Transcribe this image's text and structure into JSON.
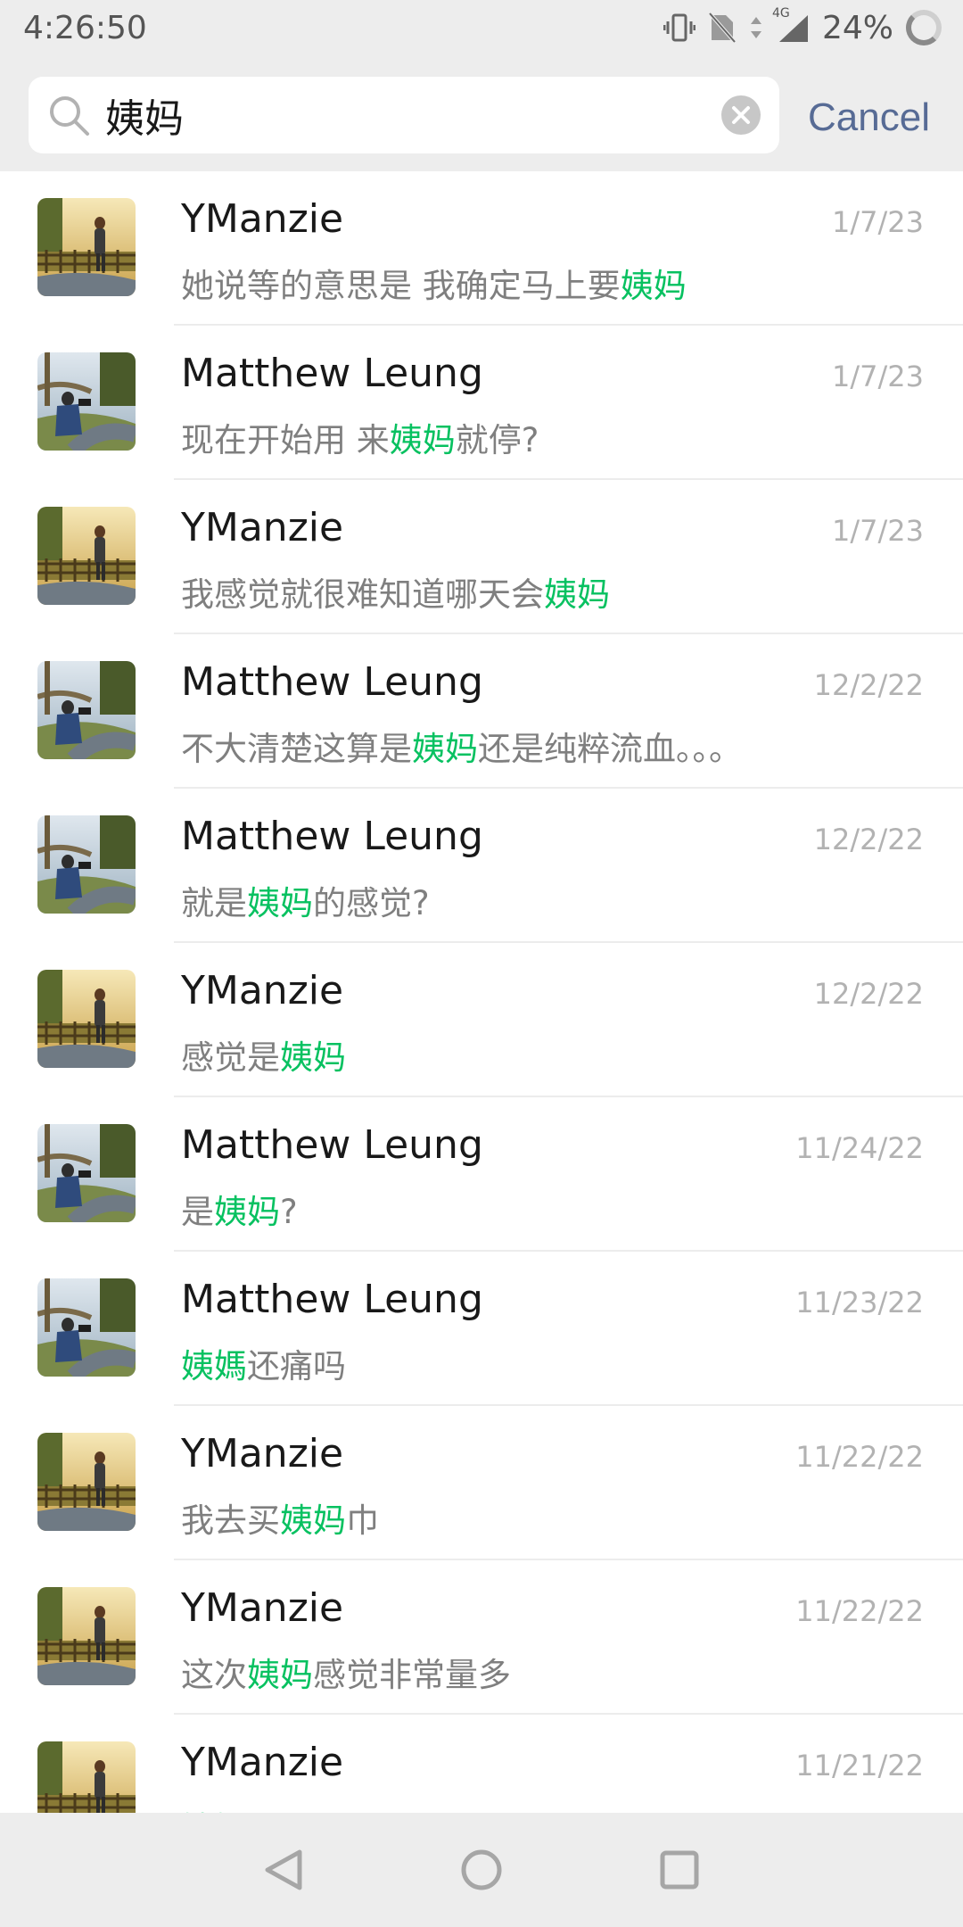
{
  "status_bar": {
    "time": "4:26:50",
    "network": "4G",
    "battery": "24%",
    "icons": [
      "vibrate-icon",
      "no-sim-icon",
      "data-arrows-icon",
      "signal-icon",
      "battery-ring-icon"
    ]
  },
  "search": {
    "query": "姨妈",
    "placeholder": "",
    "cancel_label": "Cancel"
  },
  "colors": {
    "highlight": "#07c160",
    "cancel": "#576b95",
    "name": "#191919",
    "message": "#7f7f7f",
    "date": "#b2b2b2",
    "header_bg": "#ededed"
  },
  "results": [
    {
      "name": "YManzie",
      "date": "1/7/23",
      "msg_before": "她说等的意思是 我确定马上要",
      "msg_highlight": "姨妈",
      "msg_after": "",
      "avatar": "ymanzie"
    },
    {
      "name": "Matthew Leung",
      "date": "1/7/23",
      "msg_before": "现在开始用 来",
      "msg_highlight": "姨妈",
      "msg_after": "就停?",
      "avatar": "matthew"
    },
    {
      "name": "YManzie",
      "date": "1/7/23",
      "msg_before": "我感觉就很难知道哪天会",
      "msg_highlight": "姨妈",
      "msg_after": "",
      "avatar": "ymanzie"
    },
    {
      "name": "Matthew Leung",
      "date": "12/2/22",
      "msg_before": "不大清楚这算是",
      "msg_highlight": "姨妈",
      "msg_after": "还是纯粹流血。。。",
      "avatar": "matthew"
    },
    {
      "name": "Matthew Leung",
      "date": "12/2/22",
      "msg_before": "就是",
      "msg_highlight": "姨妈",
      "msg_after": "的感觉?",
      "avatar": "matthew"
    },
    {
      "name": "YManzie",
      "date": "12/2/22",
      "msg_before": "感觉是",
      "msg_highlight": "姨妈",
      "msg_after": "",
      "avatar": "ymanzie"
    },
    {
      "name": "Matthew Leung",
      "date": "11/24/22",
      "msg_before": "是",
      "msg_highlight": "姨妈",
      "msg_after": "?",
      "avatar": "matthew"
    },
    {
      "name": "Matthew Leung",
      "date": "11/23/22",
      "msg_before": "",
      "msg_highlight": "姨媽",
      "msg_after": "还痛吗",
      "avatar": "matthew"
    },
    {
      "name": "YManzie",
      "date": "11/22/22",
      "msg_before": "我去买",
      "msg_highlight": "姨妈",
      "msg_after": "巾",
      "avatar": "ymanzie"
    },
    {
      "name": "YManzie",
      "date": "11/22/22",
      "msg_before": "这次",
      "msg_highlight": "姨妈",
      "msg_after": "感觉非常量多",
      "avatar": "ymanzie"
    },
    {
      "name": "YManzie",
      "date": "11/21/22",
      "msg_before": "",
      "msg_highlight": "姨妈",
      "msg_after": "",
      "avatar": "ymanzie"
    }
  ],
  "nav_bar": {
    "buttons": [
      "back-triangle-icon",
      "home-circle-icon",
      "recents-square-icon"
    ]
  }
}
